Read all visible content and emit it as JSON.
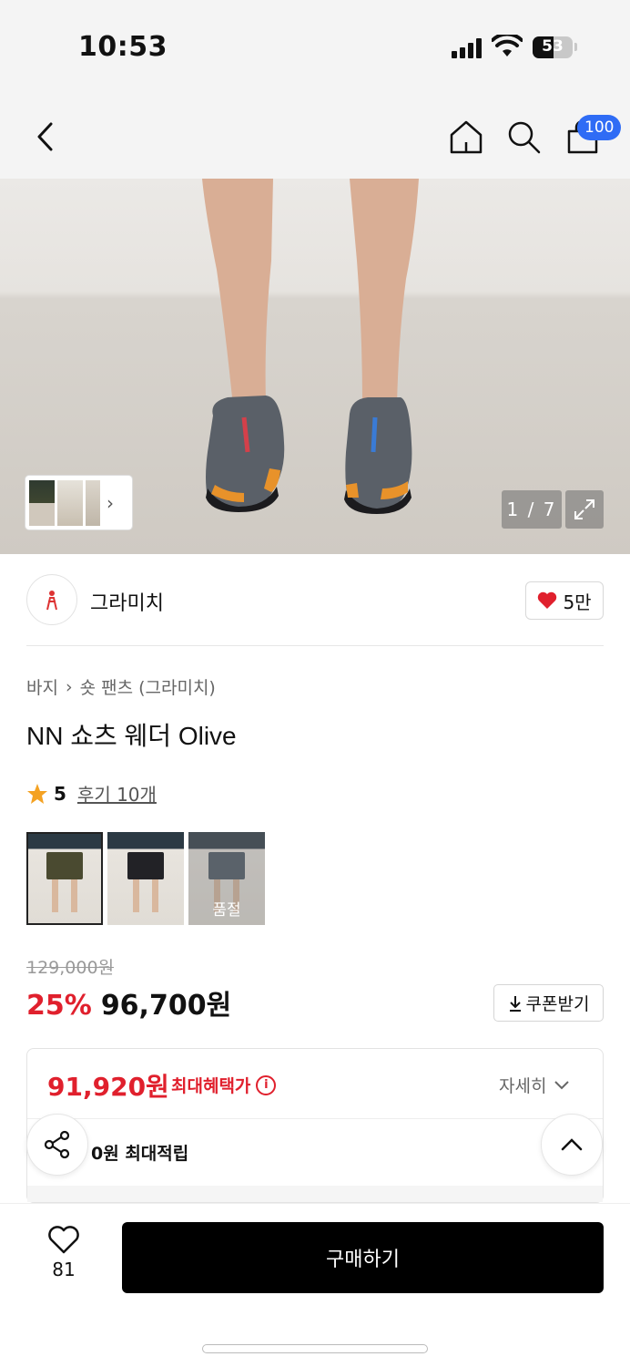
{
  "status_bar": {
    "time": "10:53",
    "battery": "53"
  },
  "nav": {
    "cart_count": "100"
  },
  "gallery": {
    "counter": "1 / 7"
  },
  "brand": {
    "name": "그라미치",
    "likes": "5만"
  },
  "breadcrumb": {
    "category": "바지",
    "subcategory": "숏 팬츠 (그라미치)"
  },
  "product": {
    "title": "NN 쇼츠 웨더 Olive",
    "rating": "5",
    "reviews": "후기 10개",
    "swatches": [
      {
        "color": "#4a4a30",
        "selected": true,
        "label": ""
      },
      {
        "color": "#222226",
        "selected": false,
        "label": ""
      },
      {
        "color": "#4b5763",
        "selected": false,
        "label": "품절"
      }
    ],
    "original_price": "129,000원",
    "discount": "25%",
    "price": "96,700원",
    "coupon_label": "쿠폰받기"
  },
  "benefit": {
    "max_price": "91,920원",
    "max_label": "최대혜택가",
    "detail_label": "자세히",
    "points": "0원 최대적립"
  },
  "bottom": {
    "wish_count": "81",
    "buy_label": "구매하기"
  },
  "colors": {
    "accent_red": "#e0202d",
    "badge_blue": "#2f6cf5"
  }
}
